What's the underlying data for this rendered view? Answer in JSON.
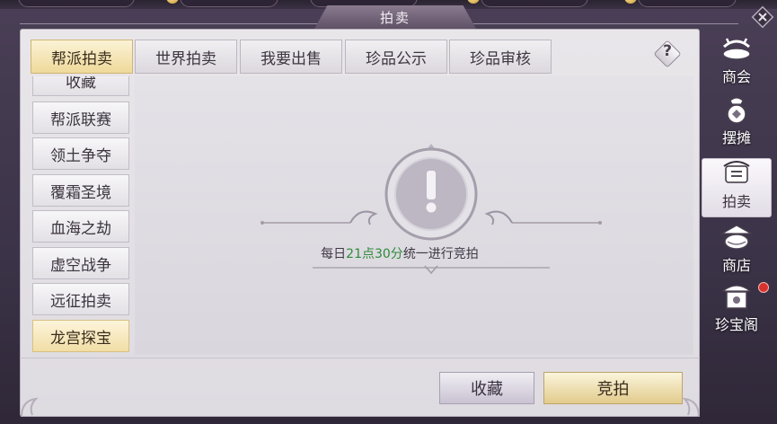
{
  "title": "拍卖",
  "tabs": [
    {
      "label": "帮派拍卖",
      "active": true
    },
    {
      "label": "世界拍卖",
      "active": false
    },
    {
      "label": "我要出售",
      "active": false
    },
    {
      "label": "珍品公示",
      "active": false
    },
    {
      "label": "珍品审核",
      "active": false
    }
  ],
  "help_icon": "?",
  "left_list": [
    {
      "label": "收藏",
      "active": false
    },
    {
      "label": "帮派联赛",
      "active": false
    },
    {
      "label": "领土争夺",
      "active": false
    },
    {
      "label": "覆霜圣境",
      "active": false
    },
    {
      "label": "血海之劫",
      "active": false
    },
    {
      "label": "虚空战争",
      "active": false
    },
    {
      "label": "远征拍卖",
      "active": false
    },
    {
      "label": "龙宫探宝",
      "active": true
    }
  ],
  "empty_notice": {
    "prefix": "每日",
    "time": "21点30分",
    "suffix": "统一进行竞拍"
  },
  "side_nav": [
    {
      "label": "商会",
      "icon": "guild-shop-icon",
      "active": false
    },
    {
      "label": "摆摊",
      "icon": "stall-bag-icon",
      "active": false
    },
    {
      "label": "拍卖",
      "icon": "auction-icon",
      "active": true
    },
    {
      "label": "商店",
      "icon": "shop-icon",
      "active": false
    },
    {
      "label": "珍宝阁",
      "icon": "treasure-pavilion-icon",
      "active": false,
      "badge": true
    }
  ],
  "buttons": {
    "favorite": "收藏",
    "bid": "竞拍"
  },
  "colors": {
    "highlight_time": "#2f8a3a",
    "active_gold": "#efd99a",
    "badge_red": "#d8322f"
  }
}
